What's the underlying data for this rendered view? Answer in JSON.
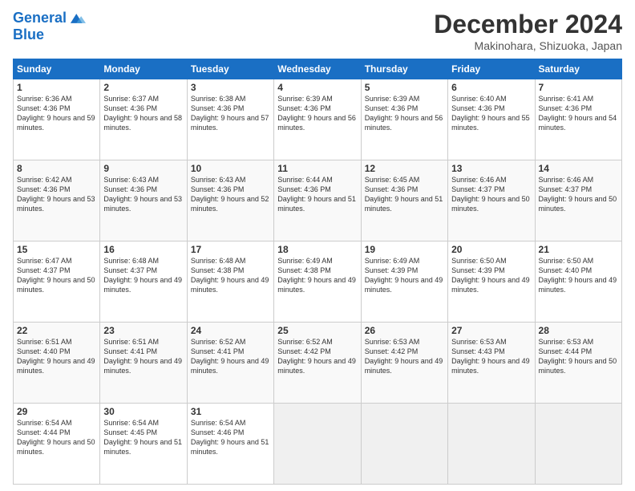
{
  "logo": {
    "line1": "General",
    "line2": "Blue"
  },
  "title": "December 2024",
  "subtitle": "Makinohara, Shizuoka, Japan",
  "days_header": [
    "Sunday",
    "Monday",
    "Tuesday",
    "Wednesday",
    "Thursday",
    "Friday",
    "Saturday"
  ],
  "weeks": [
    [
      {
        "num": "1",
        "sunrise": "6:36 AM",
        "sunset": "4:36 PM",
        "daylight": "9 hours and 59 minutes."
      },
      {
        "num": "2",
        "sunrise": "6:37 AM",
        "sunset": "4:36 PM",
        "daylight": "9 hours and 58 minutes."
      },
      {
        "num": "3",
        "sunrise": "6:38 AM",
        "sunset": "4:36 PM",
        "daylight": "9 hours and 57 minutes."
      },
      {
        "num": "4",
        "sunrise": "6:39 AM",
        "sunset": "4:36 PM",
        "daylight": "9 hours and 56 minutes."
      },
      {
        "num": "5",
        "sunrise": "6:39 AM",
        "sunset": "4:36 PM",
        "daylight": "9 hours and 56 minutes."
      },
      {
        "num": "6",
        "sunrise": "6:40 AM",
        "sunset": "4:36 PM",
        "daylight": "9 hours and 55 minutes."
      },
      {
        "num": "7",
        "sunrise": "6:41 AM",
        "sunset": "4:36 PM",
        "daylight": "9 hours and 54 minutes."
      }
    ],
    [
      {
        "num": "8",
        "sunrise": "6:42 AM",
        "sunset": "4:36 PM",
        "daylight": "9 hours and 53 minutes."
      },
      {
        "num": "9",
        "sunrise": "6:43 AM",
        "sunset": "4:36 PM",
        "daylight": "9 hours and 53 minutes."
      },
      {
        "num": "10",
        "sunrise": "6:43 AM",
        "sunset": "4:36 PM",
        "daylight": "9 hours and 52 minutes."
      },
      {
        "num": "11",
        "sunrise": "6:44 AM",
        "sunset": "4:36 PM",
        "daylight": "9 hours and 51 minutes."
      },
      {
        "num": "12",
        "sunrise": "6:45 AM",
        "sunset": "4:36 PM",
        "daylight": "9 hours and 51 minutes."
      },
      {
        "num": "13",
        "sunrise": "6:46 AM",
        "sunset": "4:37 PM",
        "daylight": "9 hours and 50 minutes."
      },
      {
        "num": "14",
        "sunrise": "6:46 AM",
        "sunset": "4:37 PM",
        "daylight": "9 hours and 50 minutes."
      }
    ],
    [
      {
        "num": "15",
        "sunrise": "6:47 AM",
        "sunset": "4:37 PM",
        "daylight": "9 hours and 50 minutes."
      },
      {
        "num": "16",
        "sunrise": "6:48 AM",
        "sunset": "4:37 PM",
        "daylight": "9 hours and 49 minutes."
      },
      {
        "num": "17",
        "sunrise": "6:48 AM",
        "sunset": "4:38 PM",
        "daylight": "9 hours and 49 minutes."
      },
      {
        "num": "18",
        "sunrise": "6:49 AM",
        "sunset": "4:38 PM",
        "daylight": "9 hours and 49 minutes."
      },
      {
        "num": "19",
        "sunrise": "6:49 AM",
        "sunset": "4:39 PM",
        "daylight": "9 hours and 49 minutes."
      },
      {
        "num": "20",
        "sunrise": "6:50 AM",
        "sunset": "4:39 PM",
        "daylight": "9 hours and 49 minutes."
      },
      {
        "num": "21",
        "sunrise": "6:50 AM",
        "sunset": "4:40 PM",
        "daylight": "9 hours and 49 minutes."
      }
    ],
    [
      {
        "num": "22",
        "sunrise": "6:51 AM",
        "sunset": "4:40 PM",
        "daylight": "9 hours and 49 minutes."
      },
      {
        "num": "23",
        "sunrise": "6:51 AM",
        "sunset": "4:41 PM",
        "daylight": "9 hours and 49 minutes."
      },
      {
        "num": "24",
        "sunrise": "6:52 AM",
        "sunset": "4:41 PM",
        "daylight": "9 hours and 49 minutes."
      },
      {
        "num": "25",
        "sunrise": "6:52 AM",
        "sunset": "4:42 PM",
        "daylight": "9 hours and 49 minutes."
      },
      {
        "num": "26",
        "sunrise": "6:53 AM",
        "sunset": "4:42 PM",
        "daylight": "9 hours and 49 minutes."
      },
      {
        "num": "27",
        "sunrise": "6:53 AM",
        "sunset": "4:43 PM",
        "daylight": "9 hours and 49 minutes."
      },
      {
        "num": "28",
        "sunrise": "6:53 AM",
        "sunset": "4:44 PM",
        "daylight": "9 hours and 50 minutes."
      }
    ],
    [
      {
        "num": "29",
        "sunrise": "6:54 AM",
        "sunset": "4:44 PM",
        "daylight": "9 hours and 50 minutes."
      },
      {
        "num": "30",
        "sunrise": "6:54 AM",
        "sunset": "4:45 PM",
        "daylight": "9 hours and 51 minutes."
      },
      {
        "num": "31",
        "sunrise": "6:54 AM",
        "sunset": "4:46 PM",
        "daylight": "9 hours and 51 minutes."
      },
      null,
      null,
      null,
      null
    ]
  ]
}
